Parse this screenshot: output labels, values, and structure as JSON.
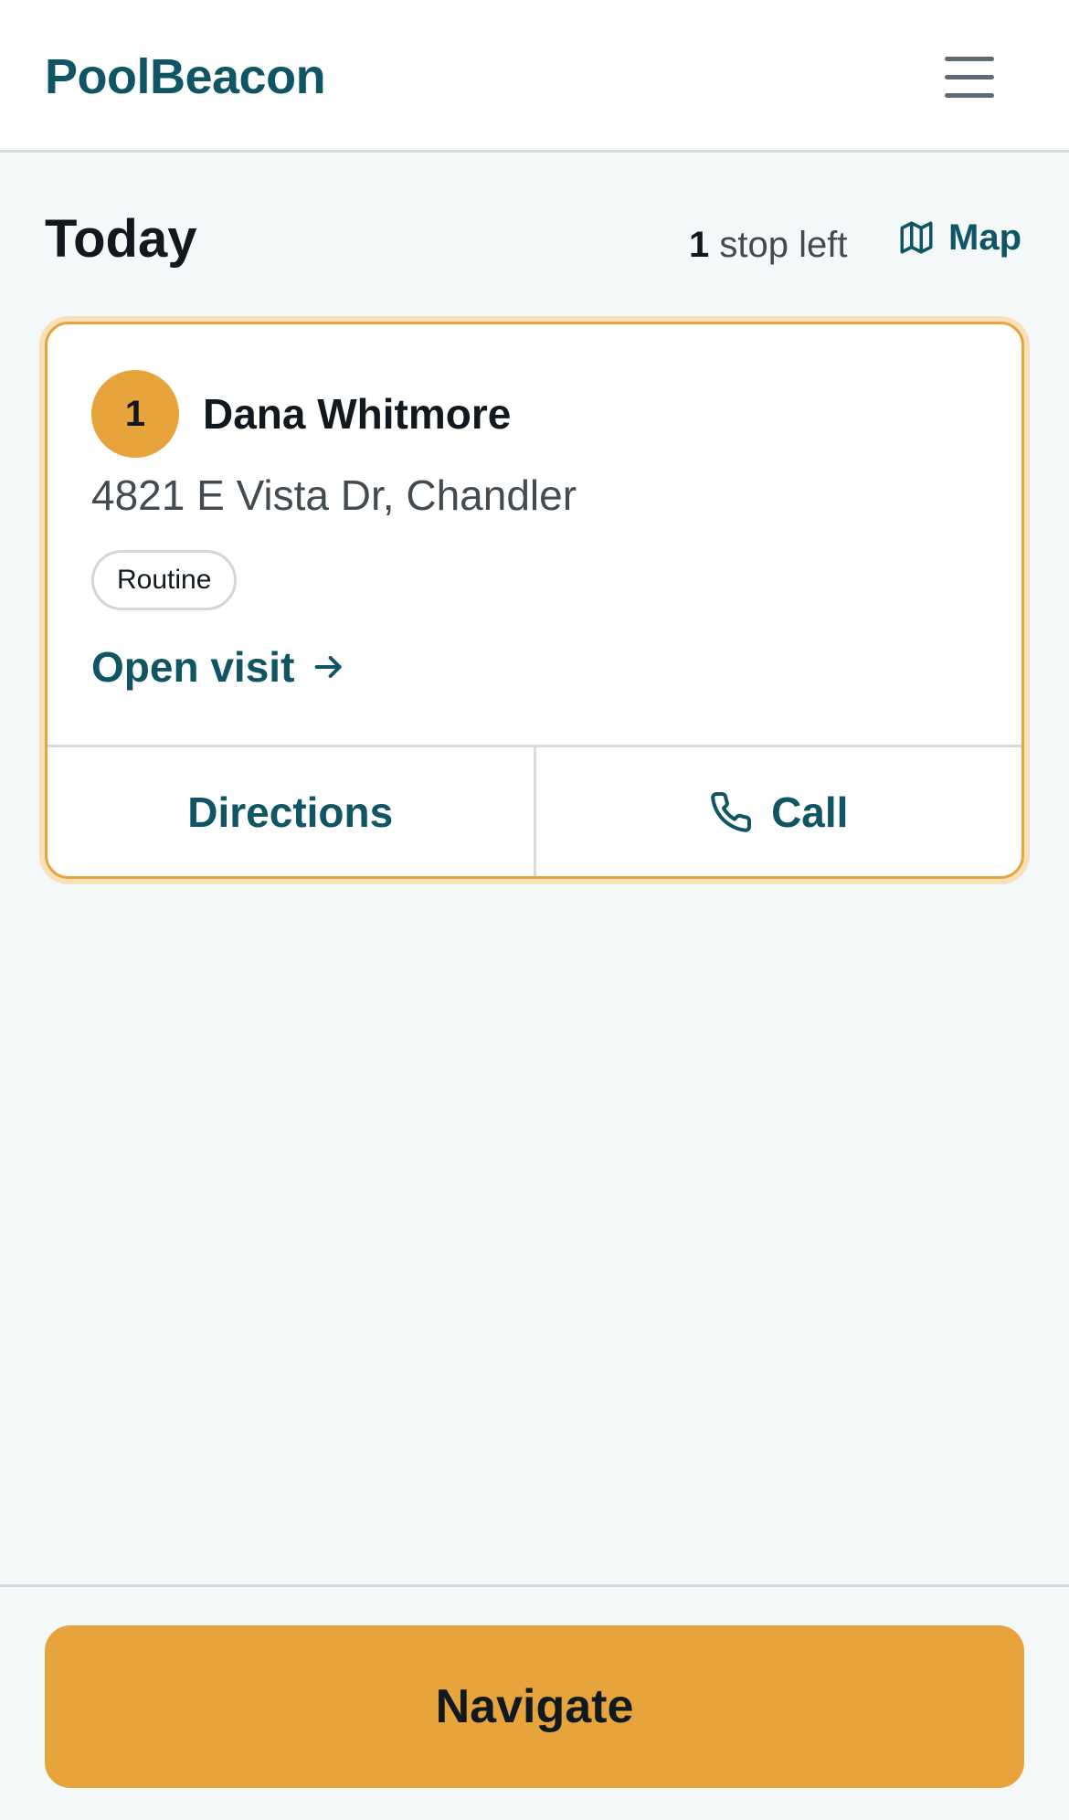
{
  "app": {
    "brand": "PoolBeacon"
  },
  "header": {
    "menu_icon": "hamburger-menu-icon"
  },
  "summary": {
    "title": "Today",
    "stops_count": "1",
    "stops_label": "stop left",
    "map_label": "Map",
    "map_icon": "map-icon"
  },
  "stop": {
    "number": "1",
    "customer_name": "Dana Whitmore",
    "address": "4821 E Vista Dr, Chandler",
    "tag": "Routine",
    "open_visit_label": "Open visit",
    "open_visit_icon": "arrow-right-icon",
    "actions": {
      "directions_label": "Directions",
      "call_label": "Call",
      "call_icon": "phone-icon"
    }
  },
  "footer": {
    "navigate_label": "Navigate"
  },
  "colors": {
    "brand_teal": "#0f5563",
    "accent_amber": "#e7a43c",
    "background": "#f4f8f9",
    "card_background": "#ffffff",
    "text_dark": "#11191e",
    "text_muted": "#434b50"
  }
}
